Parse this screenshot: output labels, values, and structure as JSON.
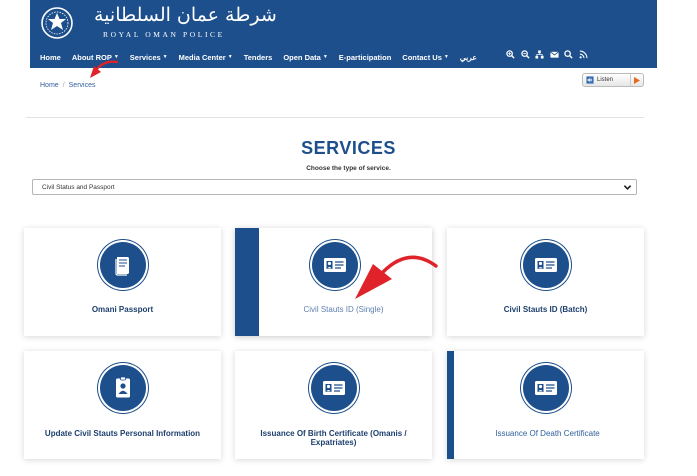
{
  "header": {
    "brand_arabic": "شرطة عمان السلطانية",
    "brand_english": "ROYAL OMAN POLICE",
    "nav": [
      {
        "label": "Home",
        "has_caret": false
      },
      {
        "label": "About ROP",
        "has_caret": true
      },
      {
        "label": "Services",
        "has_caret": true
      },
      {
        "label": "Media Center",
        "has_caret": true
      },
      {
        "label": "Tenders",
        "has_caret": false
      },
      {
        "label": "Open Data",
        "has_caret": true
      },
      {
        "label": "E-participation",
        "has_caret": false
      },
      {
        "label": "Contact Us",
        "has_caret": true
      },
      {
        "label": "عربي",
        "has_caret": false
      }
    ],
    "nav_icons": [
      "zoom-in-icon",
      "zoom-out-icon",
      "sitemap-icon",
      "mail-icon",
      "search-icon",
      "rss-icon"
    ]
  },
  "breadcrumb": {
    "home": "Home",
    "separator": "/",
    "current": "Services"
  },
  "listen": {
    "label": "Listen"
  },
  "page": {
    "title": "SERVICES",
    "subtitle": "Choose the type of service."
  },
  "service_type_select": {
    "value": "Civil Status and Passport"
  },
  "cards": [
    {
      "title": "Omani Passport",
      "icon": "passport-icon"
    },
    {
      "title": "Civil Stauts ID (Single)",
      "icon": "id-card-icon"
    },
    {
      "title": "Civil Stauts ID (Batch)",
      "icon": "id-card-icon"
    },
    {
      "title": "Update Civil Stauts Personal Information",
      "icon": "person-badge-icon"
    },
    {
      "title": "Issuance Of Birth Certificate (Omanis / Expatriates)",
      "icon": "id-card-icon"
    },
    {
      "title": "Issuance Of Death Certificate",
      "icon": "id-card-icon"
    }
  ],
  "colors": {
    "primary": "#1d4f8c",
    "annotation_arrow": "#e0222a",
    "listen_play": "#e66a1c"
  }
}
